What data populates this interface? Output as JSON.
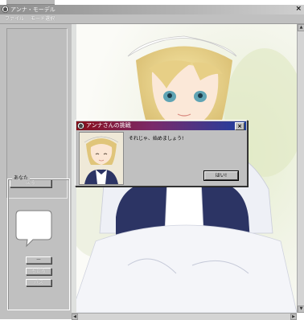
{
  "window": {
    "title": "アンナ・モーデル",
    "close_glyph": "×"
  },
  "menu": {
    "items": [
      {
        "label": "ファイル"
      },
      {
        "label": "モード選択"
      }
    ]
  },
  "left_panel": {
    "upper_button_label": "戻る",
    "group_label": "あなた",
    "buttons": [
      {
        "label": "ー"
      },
      {
        "label": "もどる"
      },
      {
        "label": "パス"
      }
    ]
  },
  "dialog": {
    "title": "アンナさんの挑戦",
    "close_glyph": "×",
    "message": "それじゃ、始めましょう!",
    "ok_label": "はい!"
  },
  "scrollbars": {
    "up_arrow": "▲",
    "down_arrow": "▼",
    "left_arrow": "◀",
    "right_arrow": "▶"
  },
  "colors": {
    "window_face": "#c0c0c0",
    "dialog_title_start": "#8a0f1a",
    "dialog_title_end": "#1e3fa0"
  }
}
